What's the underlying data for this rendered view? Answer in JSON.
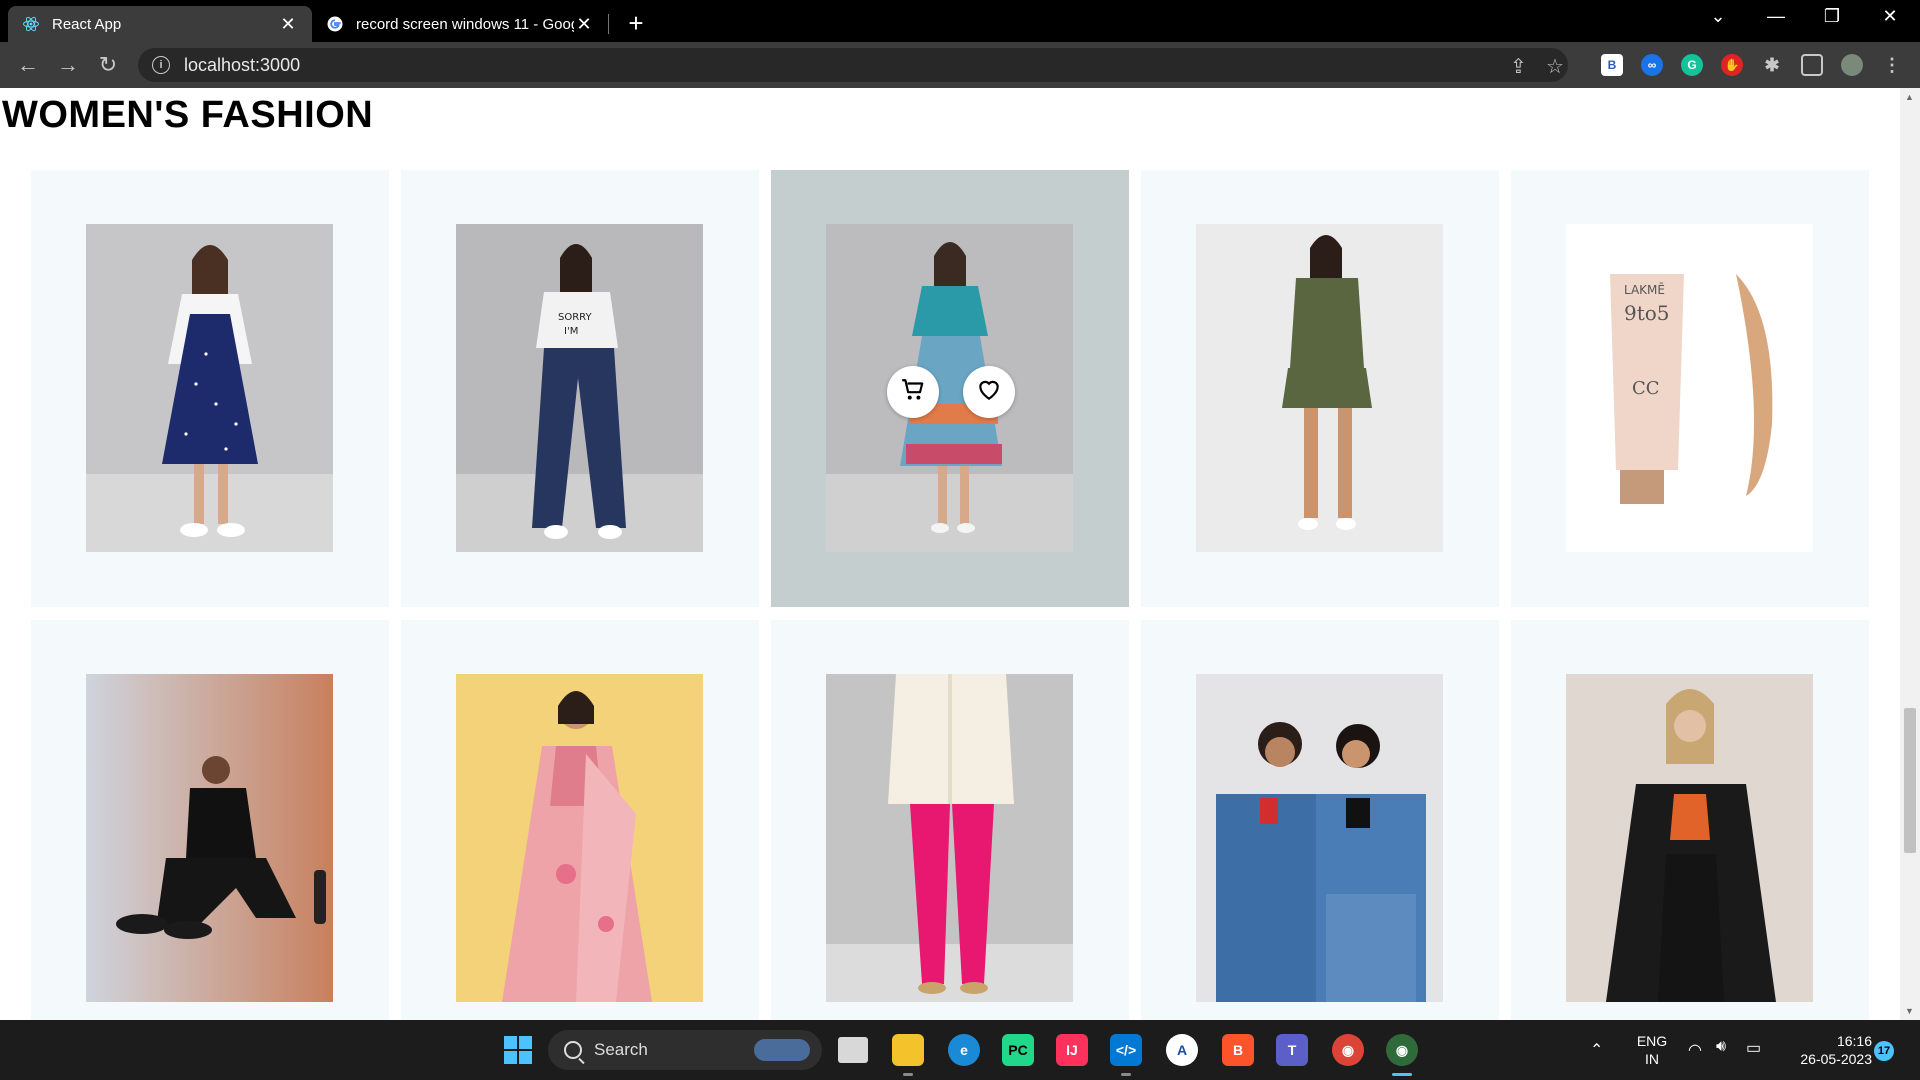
{
  "browser": {
    "tabs": [
      {
        "title": "React App",
        "active": true
      },
      {
        "title": "record screen windows 11 - Goog",
        "active": false
      }
    ],
    "url": "localhost:3000"
  },
  "page": {
    "section_title": "WOMEN'S FASHION",
    "products": [
      {
        "item": "dress-white-shrug"
      },
      {
        "item": "crop-tee-wide-jeans"
      },
      {
        "item": "teal-top-floral-skirt",
        "hovered": true
      },
      {
        "item": "olive-playsuit"
      },
      {
        "item": "lakme-cc-cream"
      },
      {
        "item": "black-activewear"
      },
      {
        "item": "pink-saree"
      },
      {
        "item": "white-kurta-pink-leggings"
      },
      {
        "item": "denim-jackets-couple"
      },
      {
        "item": "black-blazer-orange-top"
      }
    ],
    "hover_actions": [
      "cart-icon",
      "heart-icon"
    ]
  },
  "taskbar": {
    "search_label": "Search",
    "lang_line1": "ENG",
    "lang_line2": "IN",
    "time": "16:16",
    "date": "26-05-2023",
    "notif_count": "17"
  }
}
